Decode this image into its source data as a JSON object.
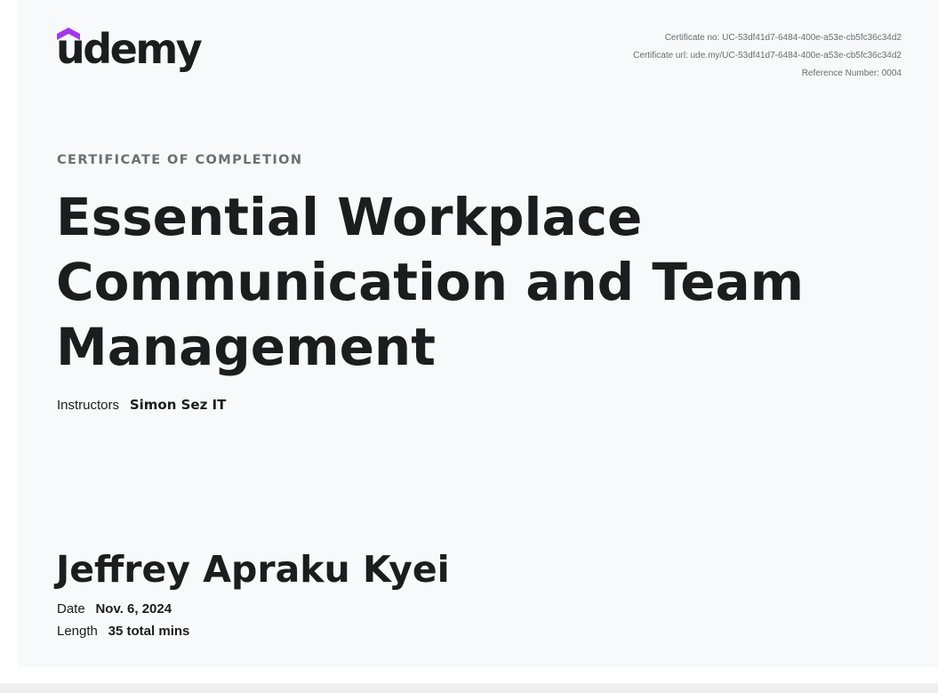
{
  "brand": {
    "name": "udemy",
    "accent_color": "#a435f0",
    "text_color": "#1c1d1f",
    "icon": "udemy-logo-icon"
  },
  "meta": {
    "certificate_no": "Certificate no: UC-53df41d7-6484-400e-a53e-cb5fc36c34d2",
    "certificate_url": "Certificate url: ude.my/UC-53df41d7-6484-400e-a53e-cb5fc36c34d2",
    "reference_number": "Reference Number: 0004"
  },
  "certificate": {
    "label": "CERTIFICATE OF COMPLETION",
    "course_title": "Essential Workplace Communication and Team Management",
    "instructors_label": "Instructors",
    "instructors_value": "Simon Sez IT",
    "recipient_name": "Jeffrey Apraku Kyei",
    "date_label": "Date",
    "date_value": "Nov. 6, 2024",
    "length_label": "Length",
    "length_value": "35 total mins"
  },
  "colors": {
    "background": "#f7f9fa",
    "muted_text": "#6a6f73"
  }
}
